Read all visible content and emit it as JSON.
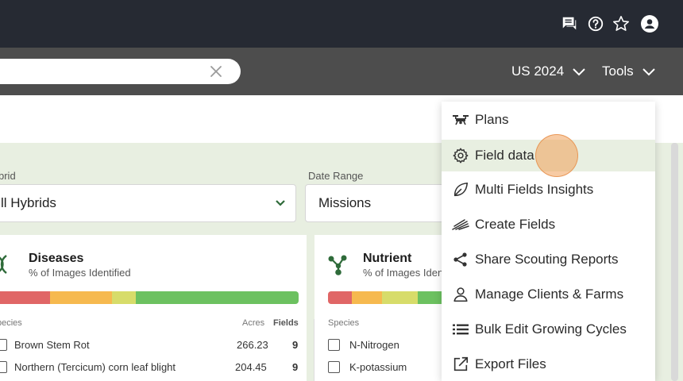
{
  "topbar": {
    "icons": [
      "chat-icon",
      "help-icon",
      "star-icon",
      "user-icon"
    ]
  },
  "subbar": {
    "search": {
      "value": "",
      "placeholder": ""
    },
    "season_label": "US 2024",
    "tools_label": "Tools"
  },
  "filters": {
    "hybrid_label": "brid",
    "hybrid_value": "ll Hybrids",
    "date_label": "Date Range",
    "date_value": "Missions"
  },
  "diseases": {
    "title": "Diseases",
    "subtitle": "% of Images Identified",
    "bar_segments": [
      {
        "color": "#e06666",
        "fraction": 0.19
      },
      {
        "color": "#f6b94f",
        "fraction": 0.2
      },
      {
        "color": "#d7dc6a",
        "fraction": 0.08
      },
      {
        "color": "#6cc160",
        "fraction": 0.53
      }
    ],
    "col_species": "pecies",
    "col_acres": "Acres",
    "col_fields": "Fields",
    "rows": [
      {
        "species": "Brown Stem Rot",
        "acres": "266.23",
        "fields": "9"
      },
      {
        "species": "Northern (Tercicum) corn leaf blight",
        "acres": "204.45",
        "fields": "9"
      }
    ]
  },
  "nutrient": {
    "title": "Nutrient",
    "subtitle": "% of Images Ident",
    "bar_segments": [
      {
        "color": "#e06666",
        "fraction": 0.2
      },
      {
        "color": "#f6b94f",
        "fraction": 0.25
      },
      {
        "color": "#d7dc6a",
        "fraction": 0.3
      },
      {
        "color": "#6cc160",
        "fraction": 0.25
      }
    ],
    "col_species": "Species",
    "rows": [
      {
        "species": "N-Nitrogen"
      },
      {
        "species": "K-potassium"
      }
    ]
  },
  "tools_menu": {
    "highlighted_index": 1,
    "items": [
      {
        "label": "Plans",
        "icon": "drone-icon"
      },
      {
        "label": "Field data",
        "icon": "gear-icon"
      },
      {
        "label": "Multi Fields Insights",
        "icon": "leaf-icon"
      },
      {
        "label": "Create Fields",
        "icon": "field-lines-icon"
      },
      {
        "label": "Share Scouting Reports",
        "icon": "share-icon"
      },
      {
        "label": "Manage Clients & Farms",
        "icon": "person-icon"
      },
      {
        "label": "Bulk Edit Growing Cycles",
        "icon": "list-icon"
      },
      {
        "label": "Export Files",
        "icon": "export-icon"
      }
    ]
  },
  "colors": {
    "topbar": "#262a33",
    "subbar": "#4d4d4d",
    "content_bg": "#e8efe1",
    "accent_green": "#2f6b3a",
    "cursor": "#f0a05a"
  }
}
